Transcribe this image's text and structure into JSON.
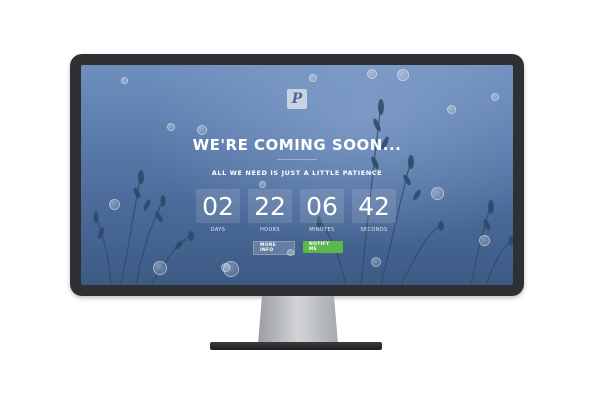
{
  "page": {
    "headline": "WE'RE COMING SOON...",
    "subheadline": "ALL WE NEED IS JUST A LITTLE PATIENCE",
    "logo_letter": "P"
  },
  "countdown": [
    {
      "value": "02",
      "label": "DAYS"
    },
    {
      "value": "22",
      "label": "HOURS"
    },
    {
      "value": "06",
      "label": "MINUTES"
    },
    {
      "value": "42",
      "label": "SECONDS"
    }
  ],
  "buttons": {
    "more_info": "MORE INFO",
    "notify_me": "NOTIFY ME"
  },
  "colors": {
    "bezel": "#2e3033",
    "screen_top": "#6f8fbd",
    "screen_bottom": "#3d5a84",
    "accent_green": "#5bb84a",
    "stand": "#b9bcbf"
  }
}
